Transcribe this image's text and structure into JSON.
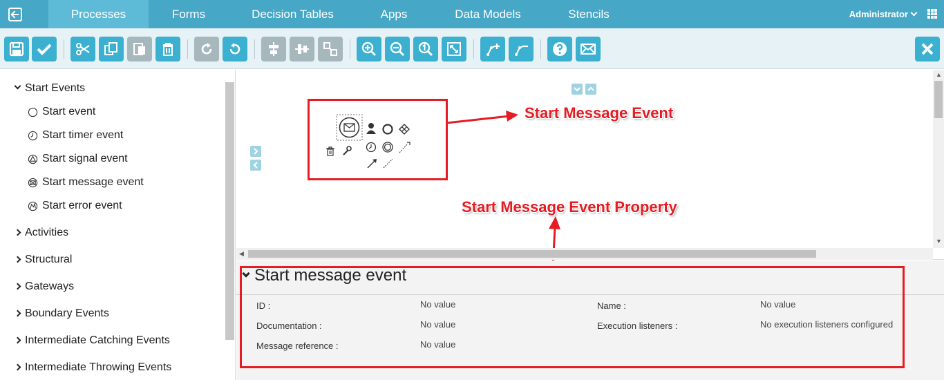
{
  "nav": {
    "tabs": [
      "Processes",
      "Forms",
      "Decision Tables",
      "Apps",
      "Data Models",
      "Stencils"
    ],
    "active_tab": "Processes",
    "user": "Administrator"
  },
  "toolbar": {
    "icons": [
      "save-icon",
      "validate-icon",
      "cut-icon",
      "copy-icon",
      "paste-icon",
      "delete-icon",
      "redo-icon",
      "undo-icon",
      "align-horizontal-icon",
      "align-vertical-icon",
      "same-size-icon",
      "zoom-in-icon",
      "zoom-out-icon",
      "zoom-actual-icon",
      "zoom-fit-icon",
      "bend-point-add-icon",
      "bend-point-remove-icon",
      "help-icon",
      "feedback-mail-icon",
      "close-icon"
    ]
  },
  "sidebar": {
    "groups": [
      {
        "label": "Start Events",
        "expanded": true,
        "items": [
          "Start event",
          "Start timer event",
          "Start signal event",
          "Start message event",
          "Start error event"
        ]
      },
      {
        "label": "Activities"
      },
      {
        "label": "Structural"
      },
      {
        "label": "Gateways"
      },
      {
        "label": "Boundary Events"
      },
      {
        "label": "Intermediate Catching Events"
      },
      {
        "label": "Intermediate Throwing Events"
      }
    ]
  },
  "annotations": {
    "event": "Start Message Event",
    "property": "Start Message Event Property"
  },
  "properties": {
    "title": "Start message event",
    "fields": [
      {
        "label": "ID :",
        "value": "No value"
      },
      {
        "label": "Name :",
        "value": "No value"
      },
      {
        "label": "Documentation :",
        "value": "No value"
      },
      {
        "label": "Execution listeners :",
        "value": "No execution listeners configured"
      },
      {
        "label": "Message reference :",
        "value": "No value"
      }
    ]
  },
  "colors": {
    "nav": "#46a7c7",
    "button": "#3bb0d0",
    "annotation": "#e51c23"
  }
}
